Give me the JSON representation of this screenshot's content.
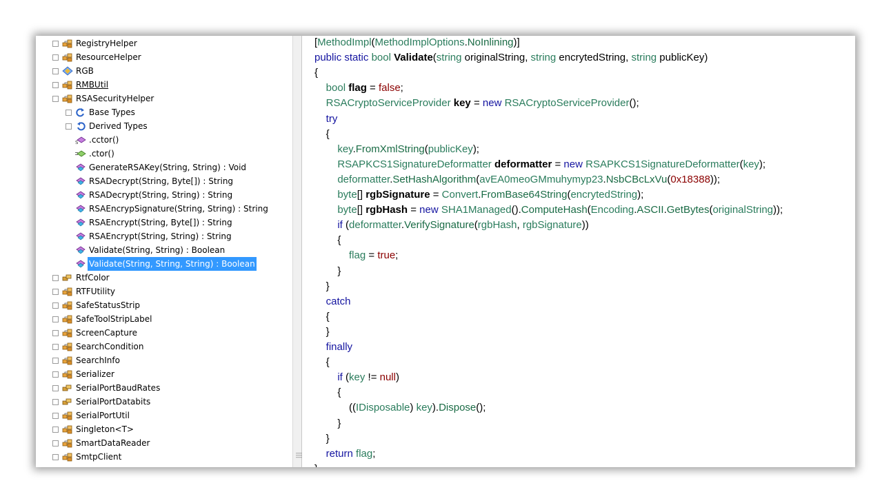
{
  "tree": {
    "items": [
      {
        "label": "RegistryHelper",
        "expander": "+",
        "icon": "class-icon"
      },
      {
        "label": "ResourceHelper",
        "expander": "+",
        "icon": "class-icon"
      },
      {
        "label": "RGB",
        "expander": "+",
        "icon": "struct-icon"
      },
      {
        "label": "RMBUtil",
        "expander": "+",
        "icon": "class-icon"
      },
      {
        "label": "RSASecurityHelper",
        "expander": "−",
        "icon": "class-icon"
      },
      {
        "label": "Base Types",
        "expander": "+",
        "icon": "base-types-icon"
      },
      {
        "label": "Derived Types",
        "expander": "+",
        "icon": "derived-types-icon"
      },
      {
        "label": ".cctor()",
        "expander": "",
        "icon": "static-method-icon"
      },
      {
        "label": ".ctor()",
        "expander": "",
        "icon": "constructor-icon"
      },
      {
        "label": "GenerateRSAKey(String, String) : Void",
        "expander": "",
        "icon": "method-icon"
      },
      {
        "label": "RSADecrypt(String, Byte[]) : String",
        "expander": "",
        "icon": "method-icon"
      },
      {
        "label": "RSADecrypt(String, String) : String",
        "expander": "",
        "icon": "method-icon"
      },
      {
        "label": "RSAEncrypSignature(String, String) : String",
        "expander": "",
        "icon": "method-icon"
      },
      {
        "label": "RSAEncrypt(String, Byte[]) : String",
        "expander": "",
        "icon": "method-icon"
      },
      {
        "label": "RSAEncrypt(String, String) : String",
        "expander": "",
        "icon": "method-icon"
      },
      {
        "label": "Validate(String, String) : Boolean",
        "expander": "",
        "icon": "method-icon"
      },
      {
        "label": "Validate(String, String, String) : Boolean",
        "expander": "",
        "icon": "method-icon"
      },
      {
        "label": "RtfColor",
        "expander": "+",
        "icon": "enum-icon"
      },
      {
        "label": "RTFUtility",
        "expander": "+",
        "icon": "class-icon"
      },
      {
        "label": "SafeStatusStrip",
        "expander": "+",
        "icon": "class-icon"
      },
      {
        "label": "SafeToolStripLabel",
        "expander": "+",
        "icon": "class-icon"
      },
      {
        "label": "ScreenCapture",
        "expander": "+",
        "icon": "class-icon"
      },
      {
        "label": "SearchCondition",
        "expander": "+",
        "icon": "class-icon"
      },
      {
        "label": "SearchInfo",
        "expander": "+",
        "icon": "class-icon"
      },
      {
        "label": "Serializer",
        "expander": "+",
        "icon": "class-icon"
      },
      {
        "label": "SerialPortBaudRates",
        "expander": "+",
        "icon": "enum-icon"
      },
      {
        "label": "SerialPortDatabits",
        "expander": "+",
        "icon": "enum-icon"
      },
      {
        "label": "SerialPortUtil",
        "expander": "+",
        "icon": "class-icon"
      },
      {
        "label": "Singleton<T>",
        "expander": "+",
        "icon": "class-icon"
      },
      {
        "label": "SmartDataReader",
        "expander": "+",
        "icon": "class-icon"
      },
      {
        "label": "SmtpClient",
        "expander": "+",
        "icon": "class-icon"
      }
    ]
  },
  "code": {
    "lines": [
      [
        [
          "p",
          "["
        ],
        [
          "t",
          "MethodImpl"
        ],
        [
          "p",
          "("
        ],
        [
          "t",
          "MethodImplOptions"
        ],
        [
          "p",
          "."
        ],
        [
          "f",
          "NoInlining"
        ],
        [
          "p",
          ")]"
        ]
      ],
      [
        [
          "k",
          "public"
        ],
        [
          "p",
          " "
        ],
        [
          "k",
          "static"
        ],
        [
          "p",
          " "
        ],
        [
          "t",
          "bool"
        ],
        [
          "p",
          " "
        ],
        [
          "b",
          "Validate"
        ],
        [
          "p",
          "("
        ],
        [
          "t",
          "string"
        ],
        [
          "p",
          " originalString, "
        ],
        [
          "t",
          "string"
        ],
        [
          "p",
          " encrytedString, "
        ],
        [
          "t",
          "string"
        ],
        [
          "p",
          " publicKey)"
        ]
      ],
      [
        [
          "p",
          "{"
        ]
      ],
      [
        [
          "p",
          "    "
        ],
        [
          "t",
          "bool"
        ],
        [
          "p",
          " "
        ],
        [
          "b",
          "flag"
        ],
        [
          "p",
          " = "
        ],
        [
          "n",
          "false"
        ],
        [
          "p",
          ";"
        ]
      ],
      [
        [
          "p",
          "    "
        ],
        [
          "t",
          "RSACryptoServiceProvider"
        ],
        [
          "p",
          " "
        ],
        [
          "b",
          "key"
        ],
        [
          "p",
          " = "
        ],
        [
          "k",
          "new"
        ],
        [
          "p",
          " "
        ],
        [
          "t",
          "RSACryptoServiceProvider"
        ],
        [
          "p",
          "();"
        ]
      ],
      [
        [
          "p",
          "    "
        ],
        [
          "k",
          "try"
        ]
      ],
      [
        [
          "p",
          "    {"
        ]
      ],
      [
        [
          "p",
          "        "
        ],
        [
          "t",
          "key"
        ],
        [
          "p",
          "."
        ],
        [
          "f",
          "FromXmlString"
        ],
        [
          "p",
          "("
        ],
        [
          "t",
          "publicKey"
        ],
        [
          "p",
          ");"
        ]
      ],
      [
        [
          "p",
          "        "
        ],
        [
          "t",
          "RSAPKCS1SignatureDeformatter"
        ],
        [
          "p",
          " "
        ],
        [
          "b",
          "deformatter"
        ],
        [
          "p",
          " = "
        ],
        [
          "k",
          "new"
        ],
        [
          "p",
          " "
        ],
        [
          "t",
          "RSAPKCS1SignatureDeformatter"
        ],
        [
          "p",
          "("
        ],
        [
          "t",
          "key"
        ],
        [
          "p",
          ");"
        ]
      ],
      [
        [
          "p",
          "        "
        ],
        [
          "t",
          "deformatter"
        ],
        [
          "p",
          "."
        ],
        [
          "f",
          "SetHashAlgorithm"
        ],
        [
          "p",
          "("
        ],
        [
          "t",
          "avEA0meoGMmuhymyp23"
        ],
        [
          "p",
          "."
        ],
        [
          "f",
          "NsbCBcLxVu"
        ],
        [
          "p",
          "("
        ],
        [
          "n",
          "0x18388"
        ],
        [
          "p",
          "));"
        ]
      ],
      [
        [
          "p",
          "        "
        ],
        [
          "t",
          "byte"
        ],
        [
          "p",
          "[] "
        ],
        [
          "b",
          "rgbSignature"
        ],
        [
          "p",
          " = "
        ],
        [
          "t",
          "Convert"
        ],
        [
          "p",
          "."
        ],
        [
          "f",
          "FromBase64String"
        ],
        [
          "p",
          "("
        ],
        [
          "t",
          "encrytedString"
        ],
        [
          "p",
          ");"
        ]
      ],
      [
        [
          "p",
          "        "
        ],
        [
          "t",
          "byte"
        ],
        [
          "p",
          "[] "
        ],
        [
          "b",
          "rgbHash"
        ],
        [
          "p",
          " = "
        ],
        [
          "k",
          "new"
        ],
        [
          "p",
          " "
        ],
        [
          "t",
          "SHA1Managed"
        ],
        [
          "p",
          "()."
        ],
        [
          "f",
          "ComputeHash"
        ],
        [
          "p",
          "("
        ],
        [
          "t",
          "Encoding"
        ],
        [
          "p",
          "."
        ],
        [
          "f",
          "ASCII"
        ],
        [
          "p",
          "."
        ],
        [
          "f",
          "GetBytes"
        ],
        [
          "p",
          "("
        ],
        [
          "t",
          "originalString"
        ],
        [
          "p",
          "));"
        ]
      ],
      [
        [
          "p",
          "        "
        ],
        [
          "k",
          "if"
        ],
        [
          "p",
          " ("
        ],
        [
          "t",
          "deformatter"
        ],
        [
          "p",
          "."
        ],
        [
          "f",
          "VerifySignature"
        ],
        [
          "p",
          "("
        ],
        [
          "t",
          "rgbHash"
        ],
        [
          "p",
          ", "
        ],
        [
          "t",
          "rgbSignature"
        ],
        [
          "p",
          "))"
        ]
      ],
      [
        [
          "p",
          "        {"
        ]
      ],
      [
        [
          "p",
          "            "
        ],
        [
          "t",
          "flag"
        ],
        [
          "p",
          " = "
        ],
        [
          "n",
          "true"
        ],
        [
          "p",
          ";"
        ]
      ],
      [
        [
          "p",
          "        }"
        ]
      ],
      [
        [
          "p",
          "    }"
        ]
      ],
      [
        [
          "p",
          "    "
        ],
        [
          "k",
          "catch"
        ]
      ],
      [
        [
          "p",
          "    {"
        ]
      ],
      [
        [
          "p",
          "    }"
        ]
      ],
      [
        [
          "p",
          "    "
        ],
        [
          "k",
          "finally"
        ]
      ],
      [
        [
          "p",
          "    {"
        ]
      ],
      [
        [
          "p",
          "        "
        ],
        [
          "k",
          "if"
        ],
        [
          "p",
          " ("
        ],
        [
          "t",
          "key"
        ],
        [
          "p",
          " != "
        ],
        [
          "n",
          "null"
        ],
        [
          "p",
          ")"
        ]
      ],
      [
        [
          "p",
          "        {"
        ]
      ],
      [
        [
          "p",
          "            (("
        ],
        [
          "t",
          "IDisposable"
        ],
        [
          "p",
          ") "
        ],
        [
          "t",
          "key"
        ],
        [
          "p",
          ")."
        ],
        [
          "f",
          "Dispose"
        ],
        [
          "p",
          "();"
        ]
      ],
      [
        [
          "p",
          "        }"
        ]
      ],
      [
        [
          "p",
          "    }"
        ]
      ],
      [
        [
          "p",
          "    "
        ],
        [
          "k",
          "return"
        ],
        [
          "p",
          " "
        ],
        [
          "t",
          "flag"
        ],
        [
          "p",
          ";"
        ]
      ],
      [
        [
          "p",
          "}"
        ]
      ]
    ]
  },
  "colors": {
    "selection": "#3399ff",
    "keyword": "#1414a0",
    "type": "#2a7c5c",
    "literal": "#8b0000"
  }
}
